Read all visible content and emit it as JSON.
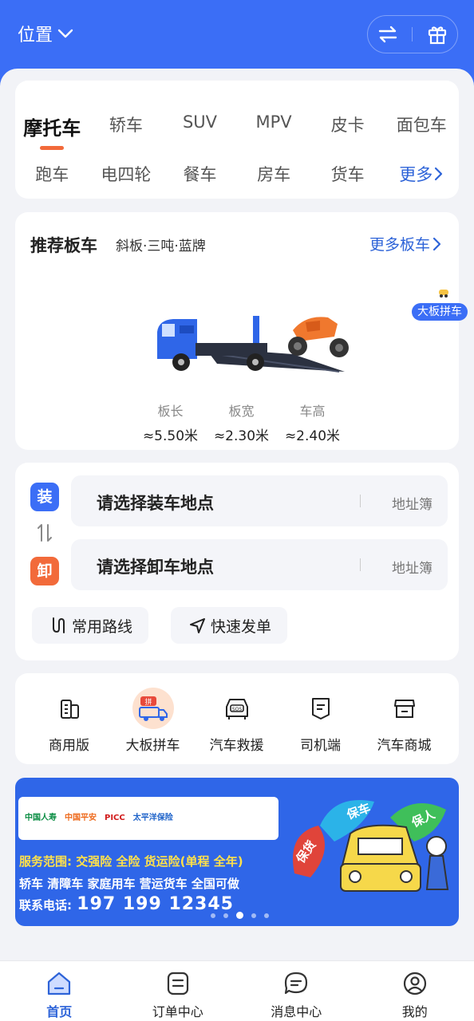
{
  "header": {
    "location_label": "位置",
    "accent_color": "#3b6ef6",
    "buttons": [
      "swap-icon",
      "gift-icon"
    ]
  },
  "vehicle_types": {
    "row1": [
      "摩托车",
      "轿车",
      "SUV",
      "MPV",
      "皮卡",
      "面包车"
    ],
    "row2": [
      "跑车",
      "电四轮",
      "餐车",
      "房车",
      "货车"
    ],
    "more_label": "更多",
    "selected": "摩托车"
  },
  "recommend": {
    "title": "推荐板车",
    "subtitle": "斜板·三吨·蓝牌",
    "more_label": "更多板车",
    "specs": [
      {
        "label": "板长",
        "value": "≈5.50米"
      },
      {
        "label": "板宽",
        "value": "≈2.30米"
      },
      {
        "label": "车高",
        "value": "≈2.40米"
      }
    ]
  },
  "floating_tag": {
    "label": "大板拼车"
  },
  "address": {
    "load_badge": "装",
    "unload_badge": "卸",
    "load_placeholder": "请选择装车地点",
    "unload_placeholder": "请选择卸车地点",
    "address_book": "地址簿",
    "common_routes": "常用路线",
    "quick_order": "快速发单"
  },
  "services": [
    {
      "label": "商用版",
      "icon": "building-icon"
    },
    {
      "label": "大板拼车",
      "icon": "carpool-truck-icon"
    },
    {
      "label": "汽车救援",
      "icon": "sos-car-icon"
    },
    {
      "label": "司机端",
      "icon": "driver-icon"
    },
    {
      "label": "汽车商城",
      "icon": "shop-icon"
    }
  ],
  "banner": {
    "insurers": [
      "中国人寿",
      "中国平安",
      "PICC",
      "太平洋保险"
    ],
    "scope_label": "服务范围:",
    "scope_items": "交强险 全险 货运险(单程 全年)",
    "vehicles": "轿车 清障车 家庭用车 营运货车 全国可做",
    "phone_label": "联系电话:",
    "phone": "197 199 12345",
    "umbrella_labels": [
      "保车",
      "保人",
      "保货"
    ],
    "page_index": 3,
    "page_count": 5
  },
  "bottom_nav": [
    {
      "label": "首页",
      "icon": "home-icon",
      "active": true
    },
    {
      "label": "订单中心",
      "icon": "order-icon",
      "active": false
    },
    {
      "label": "消息中心",
      "icon": "message-icon",
      "active": false
    },
    {
      "label": "我的",
      "icon": "profile-icon",
      "active": false
    }
  ]
}
